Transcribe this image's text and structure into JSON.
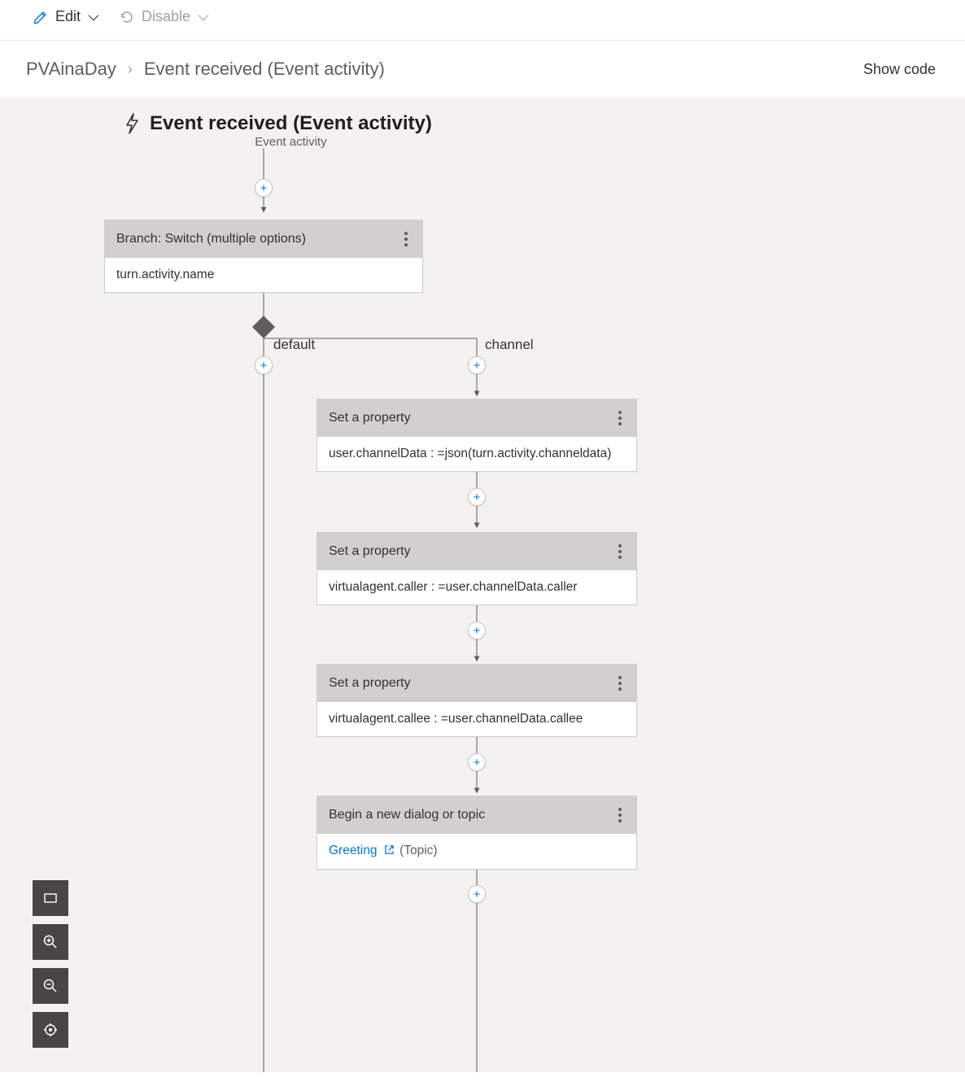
{
  "toolbar": {
    "edit_label": "Edit",
    "disable_label": "Disable"
  },
  "breadcrumb": {
    "root": "PVAinaDay",
    "page": "Event received (Event activity)"
  },
  "actions": {
    "show_code": "Show code"
  },
  "trigger": {
    "title": "Event received (Event activity)",
    "subtitle": "Event activity"
  },
  "switch_node": {
    "title": "Branch: Switch (multiple options)",
    "condition": "turn.activity.name"
  },
  "branches": {
    "default_label": "default",
    "channel_label": "channel"
  },
  "channel_steps": [
    {
      "title": "Set a property",
      "body": "user.channelData : =json(turn.activity.channeldata)"
    },
    {
      "title": "Set a property",
      "body": "virtualagent.caller : =user.channelData.caller"
    },
    {
      "title": "Set a property",
      "body": "virtualagent.callee : =user.channelData.callee"
    }
  ],
  "dialog_node": {
    "title": "Begin a new dialog or topic",
    "link": "Greeting",
    "type_label": "(Topic)"
  }
}
